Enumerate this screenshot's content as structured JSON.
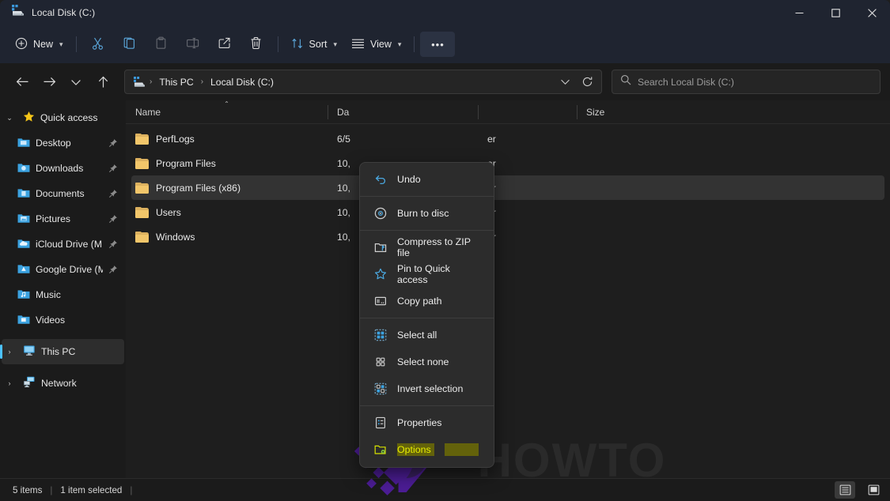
{
  "window": {
    "title": "Local Disk (C:)",
    "controls": {
      "minimize": "─",
      "maximize": "□",
      "close": "✕"
    }
  },
  "toolbar": {
    "new_label": "New",
    "sort_label": "Sort",
    "view_label": "View",
    "more_label": "•••",
    "icons": [
      "cut-icon",
      "copy-icon",
      "paste-icon",
      "rename-icon",
      "share-icon",
      "delete-icon"
    ]
  },
  "addressbar": {
    "back": "←",
    "forward": "→",
    "recent": "∨",
    "up": "↑",
    "crumbs": [
      "This PC",
      "Local Disk (C:)"
    ],
    "separator": "›",
    "refresh_title": "Refresh",
    "dropdown": "∨"
  },
  "search": {
    "placeholder": "Search Local Disk (C:)"
  },
  "sidebar": {
    "items": [
      {
        "label": "Quick access",
        "icon": "star-icon",
        "twisty": "⌄",
        "indent": false,
        "pinned": false,
        "selected": false
      },
      {
        "label": "Desktop",
        "icon": "desktop-folder-icon",
        "twisty": "",
        "indent": true,
        "pinned": true,
        "selected": false
      },
      {
        "label": "Downloads",
        "icon": "downloads-folder-icon",
        "twisty": "",
        "indent": true,
        "pinned": true,
        "selected": false
      },
      {
        "label": "Documents",
        "icon": "documents-folder-icon",
        "twisty": "",
        "indent": true,
        "pinned": true,
        "selected": false
      },
      {
        "label": "Pictures",
        "icon": "pictures-folder-icon",
        "twisty": "",
        "indent": true,
        "pinned": true,
        "selected": false
      },
      {
        "label": "iCloud Drive (M",
        "icon": "icloud-folder-icon",
        "twisty": "",
        "indent": true,
        "pinned": true,
        "selected": false
      },
      {
        "label": "Google Drive (M",
        "icon": "google-drive-folder-icon",
        "twisty": "",
        "indent": true,
        "pinned": true,
        "selected": false
      },
      {
        "label": "Music",
        "icon": "music-folder-icon",
        "twisty": "",
        "indent": true,
        "pinned": false,
        "selected": false
      },
      {
        "label": "Videos",
        "icon": "videos-folder-icon",
        "twisty": "",
        "indent": true,
        "pinned": false,
        "selected": false
      },
      {
        "label": "This PC",
        "icon": "computer-icon",
        "twisty": "›",
        "indent": false,
        "pinned": false,
        "selected": true
      },
      {
        "label": "Network",
        "icon": "network-icon",
        "twisty": "›",
        "indent": false,
        "pinned": false,
        "selected": false
      }
    ]
  },
  "filelist": {
    "columns": [
      {
        "label": "Name",
        "sorted": true,
        "sort_glyph": "⌃"
      },
      {
        "label": "Da",
        "sorted": false,
        "sort_glyph": ""
      },
      {
        "label": "",
        "sorted": false,
        "sort_glyph": ""
      },
      {
        "label": "Size",
        "sorted": false,
        "sort_glyph": ""
      }
    ],
    "rows": [
      {
        "name": "PerfLogs",
        "date": "6/5",
        "type": "er",
        "size": "",
        "selected": false
      },
      {
        "name": "Program Files",
        "date": "10,",
        "type": "er",
        "size": "",
        "selected": false
      },
      {
        "name": "Program Files (x86)",
        "date": "10,",
        "type": "er",
        "size": "",
        "selected": true
      },
      {
        "name": "Users",
        "date": "10,",
        "type": "er",
        "size": "",
        "selected": false
      },
      {
        "name": "Windows",
        "date": "10,",
        "type": "er",
        "size": "",
        "selected": false
      }
    ]
  },
  "context_menu": {
    "items": [
      {
        "label": "Undo",
        "icon": "undo-icon",
        "highlighted": false,
        "separator_after": true
      },
      {
        "label": "Burn to disc",
        "icon": "burn-disc-icon",
        "highlighted": false,
        "separator_after": true
      },
      {
        "label": "Compress to ZIP file",
        "icon": "zip-icon",
        "highlighted": false,
        "separator_after": false
      },
      {
        "label": "Pin to Quick access",
        "icon": "star-outline-icon",
        "highlighted": false,
        "separator_after": false
      },
      {
        "label": "Copy path",
        "icon": "copy-path-icon",
        "highlighted": false,
        "separator_after": true
      },
      {
        "label": "Select all",
        "icon": "select-all-icon",
        "highlighted": false,
        "separator_after": false
      },
      {
        "label": "Select none",
        "icon": "select-none-icon",
        "highlighted": false,
        "separator_after": false
      },
      {
        "label": "Invert selection",
        "icon": "invert-selection-icon",
        "highlighted": false,
        "separator_after": true
      },
      {
        "label": "Properties",
        "icon": "properties-icon",
        "highlighted": false,
        "separator_after": false
      },
      {
        "label": "Options",
        "icon": "options-folder-icon",
        "highlighted": true,
        "separator_after": false
      }
    ]
  },
  "statusbar": {
    "item_count": "5 items",
    "selection": "1 item selected",
    "separator": "|",
    "views": [
      "details-view-icon",
      "large-icons-view-icon"
    ]
  },
  "watermark": {
    "text": "HOWTO",
    "logo_color": "#4c1d95"
  },
  "colors": {
    "accent": "#4cc2ff",
    "titlebar_bg": "#1f2430",
    "window_bg": "#1e1e1e",
    "sidebar_bg": "#1b1b1b",
    "menu_bg": "#2c2c2c",
    "selection_bg": "#333333",
    "highlight_yellow": "#e8ee00",
    "highlight_bg": "#63620b",
    "folder_yellow": "#f2c66a"
  }
}
